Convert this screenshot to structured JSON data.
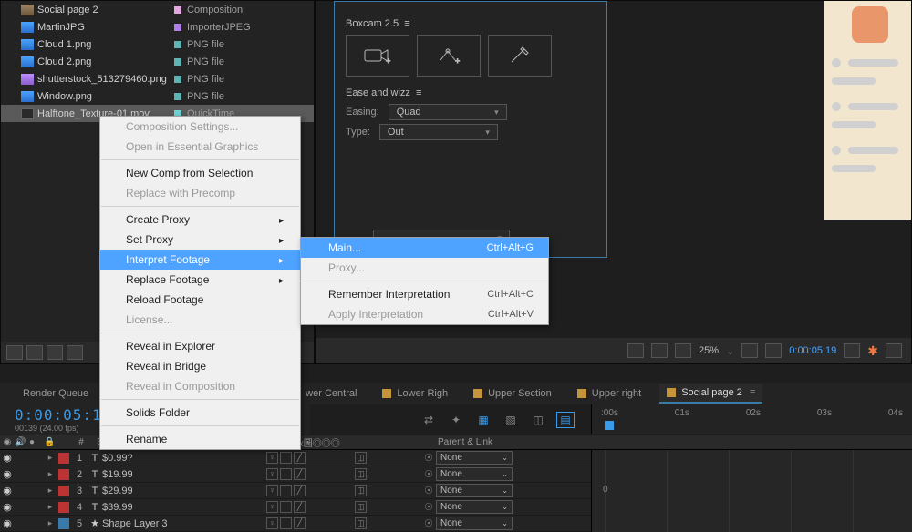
{
  "project": {
    "items": [
      {
        "name": "Social page 2",
        "type": "Composition",
        "iconClass": "fi-brown",
        "swatch": "sw-pink"
      },
      {
        "name": "MartinJPG",
        "type": "ImporterJPEG",
        "iconClass": "fi-blue",
        "swatch": "sw-purple"
      },
      {
        "name": "Cloud 1.png",
        "type": "PNG file",
        "iconClass": "fi-blue",
        "swatch": "sw-teal"
      },
      {
        "name": "Cloud 2.png",
        "type": "PNG file",
        "iconClass": "fi-blue",
        "swatch": "sw-teal"
      },
      {
        "name": "shutterstock_513279460.png",
        "type": "PNG file",
        "iconClass": "fi-purple",
        "swatch": "sw-teal"
      },
      {
        "name": "Window.png",
        "type": "PNG file",
        "iconClass": "fi-blue",
        "swatch": "sw-teal"
      },
      {
        "name": "Halftone_Texture-01.mov",
        "type": "QuickTime",
        "iconClass": "fi-mov",
        "swatch": "sw-aqua",
        "selected": true
      }
    ]
  },
  "panel": {
    "boxcamTitle": "Boxcam 2.5",
    "easeTitle": "Ease and wizz",
    "easingLabel": "Easing:",
    "easingValue": "Quad",
    "typeLabel": "Type:",
    "typeValue": "Out"
  },
  "compFooter": {
    "zoom": "25%",
    "timecode": "0:00:05:19"
  },
  "tabs": {
    "renderQueue": "Render Queue",
    "items": [
      "wer Central",
      "Lower Righ",
      "Upper Section",
      "Upper right",
      "Social page 2"
    ],
    "activeIndex": 4
  },
  "timecode": {
    "big": "0:00:05:19",
    "small": "00139 (24.00 fps)"
  },
  "ruler": {
    "ticks": [
      ":00s",
      "01s",
      "02s",
      "03s",
      "04s"
    ]
  },
  "layerHeader": {
    "num": "#",
    "source": "Source Name",
    "switches": "♀♂＼fx圖◎◎◎",
    "parent": "Parent & Link"
  },
  "layers": [
    {
      "num": "1",
      "type": "T",
      "name": "$0.99?",
      "swatch": "sw-red",
      "parent": "None"
    },
    {
      "num": "2",
      "type": "T",
      "name": "$19.99",
      "swatch": "sw-red",
      "parent": "None"
    },
    {
      "num": "3",
      "type": "T",
      "name": "$29.99",
      "swatch": "sw-red",
      "parent": "None"
    },
    {
      "num": "4",
      "type": "T",
      "name": "$39.99",
      "swatch": "sw-red",
      "parent": "None"
    },
    {
      "num": "5",
      "type": "★",
      "name": "Shape Layer 3",
      "swatch": "sw-blue",
      "parent": "None"
    }
  ],
  "layerZero": "0",
  "contextMenu": {
    "items": [
      {
        "label": "Composition Settings...",
        "disabled": true
      },
      {
        "label": "Open in Essential Graphics",
        "disabled": true
      },
      {
        "sep": true
      },
      {
        "label": "New Comp from Selection"
      },
      {
        "label": "Replace with Precomp",
        "disabled": true
      },
      {
        "sep": true
      },
      {
        "label": "Create Proxy",
        "arrow": true
      },
      {
        "label": "Set Proxy",
        "arrow": true
      },
      {
        "label": "Interpret Footage",
        "arrow": true,
        "hl": true
      },
      {
        "label": "Replace Footage",
        "arrow": true
      },
      {
        "label": "Reload Footage"
      },
      {
        "label": "License...",
        "disabled": true
      },
      {
        "sep": true
      },
      {
        "label": "Reveal in Explorer"
      },
      {
        "label": "Reveal in Bridge"
      },
      {
        "label": "Reveal in Composition",
        "disabled": true
      },
      {
        "sep": true
      },
      {
        "label": "Solids Folder"
      },
      {
        "sep": true
      },
      {
        "label": "Rename"
      }
    ]
  },
  "submenu": {
    "items": [
      {
        "label": "Main...",
        "short": "Ctrl+Alt+G",
        "hl": true
      },
      {
        "label": "Proxy...",
        "disabled": true
      },
      {
        "sep": true
      },
      {
        "label": "Remember Interpretation",
        "short": "Ctrl+Alt+C"
      },
      {
        "label": "Apply Interpretation",
        "short": "Ctrl+Alt+V",
        "disabled": true
      }
    ]
  }
}
